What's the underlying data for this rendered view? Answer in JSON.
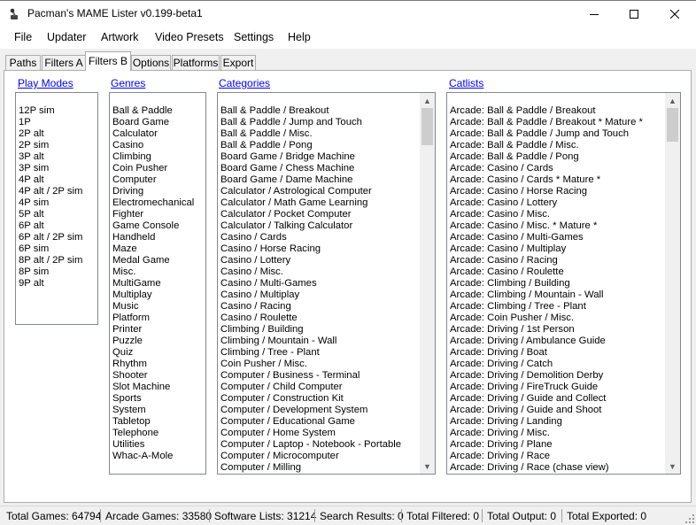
{
  "window": {
    "title": "Pacman's MAME Lister v0.199-beta1"
  },
  "menu": [
    "File",
    "Updater",
    "Artwork",
    "Video Presets",
    "Settings",
    "Help"
  ],
  "tabs": {
    "items": [
      "Paths",
      "Filters A",
      "Filters B",
      "Options",
      "Platforms",
      "Export"
    ],
    "active": "Filters B"
  },
  "play_modes": {
    "header": "Play Modes",
    "items": [
      "12P sim",
      "1P",
      "2P alt",
      "2P sim",
      "3P alt",
      "3P sim",
      "4P alt",
      "4P alt / 2P sim",
      "4P sim",
      "5P alt",
      "6P alt",
      "6P alt / 2P sim",
      "6P sim",
      "8P alt / 2P sim",
      "8P sim",
      "9P alt"
    ]
  },
  "genres": {
    "header": "Genres",
    "items": [
      "Ball & Paddle",
      "Board Game",
      "Calculator",
      "Casino",
      "Climbing",
      "Coin Pusher",
      "Computer",
      "Driving",
      "Electromechanical",
      "Fighter",
      "Game Console",
      "Handheld",
      "Maze",
      "Medal Game",
      "Misc.",
      "MultiGame",
      "Multiplay",
      "Music",
      "Platform",
      "Printer",
      "Puzzle",
      "Quiz",
      "Rhythm",
      "Shooter",
      "Slot Machine",
      "Sports",
      "System",
      "Tabletop",
      "Telephone",
      "Utilities",
      "Whac-A-Mole"
    ]
  },
  "categories": {
    "header": "Categories",
    "items": [
      "Ball & Paddle / Breakout",
      "Ball & Paddle / Jump and Touch",
      "Ball & Paddle / Misc.",
      "Ball & Paddle / Pong",
      "Board Game / Bridge Machine",
      "Board Game / Chess Machine",
      "Board Game / Dame Machine",
      "Calculator / Astrological Computer",
      "Calculator / Math Game Learning",
      "Calculator / Pocket Computer",
      "Calculator / Talking Calculator",
      "Casino / Cards",
      "Casino / Horse Racing",
      "Casino / Lottery",
      "Casino / Misc.",
      "Casino / Multi-Games",
      "Casino / Multiplay",
      "Casino / Racing",
      "Casino / Roulette",
      "Climbing / Building",
      "Climbing / Mountain - Wall",
      "Climbing / Tree - Plant",
      "Coin Pusher / Misc.",
      "Computer / Business - Terminal",
      "Computer / Child Computer",
      "Computer / Construction Kit",
      "Computer / Development System",
      "Computer / Educational Game",
      "Computer / Home System",
      "Computer / Laptop - Notebook - Portable",
      "Computer / Microcomputer",
      "Computer / Milling"
    ]
  },
  "catlists": {
    "header": "Catlists",
    "items": [
      "Arcade: Ball & Paddle / Breakout",
      "Arcade: Ball & Paddle / Breakout * Mature *",
      "Arcade: Ball & Paddle / Jump and Touch",
      "Arcade: Ball & Paddle / Misc.",
      "Arcade: Ball & Paddle / Pong",
      "Arcade: Casino / Cards",
      "Arcade: Casino / Cards * Mature *",
      "Arcade: Casino / Horse Racing",
      "Arcade: Casino / Lottery",
      "Arcade: Casino / Misc.",
      "Arcade: Casino / Misc. * Mature *",
      "Arcade: Casino / Multi-Games",
      "Arcade: Casino / Multiplay",
      "Arcade: Casino / Racing",
      "Arcade: Casino / Roulette",
      "Arcade: Climbing / Building",
      "Arcade: Climbing / Mountain - Wall",
      "Arcade: Climbing / Tree - Plant",
      "Arcade: Coin Pusher / Misc.",
      "Arcade: Driving / 1st Person",
      "Arcade: Driving / Ambulance Guide",
      "Arcade: Driving / Boat",
      "Arcade: Driving / Catch",
      "Arcade: Driving / Demolition Derby",
      "Arcade: Driving / FireTruck Guide",
      "Arcade: Driving / Guide and Collect",
      "Arcade: Driving / Guide and Shoot",
      "Arcade: Driving / Landing",
      "Arcade: Driving / Misc.",
      "Arcade: Driving / Plane",
      "Arcade: Driving / Race",
      "Arcade: Driving / Race (chase view)"
    ]
  },
  "status": {
    "total_games": "Total Games: 64794",
    "arcade_games": "Arcade Games: 33580",
    "software_lists": "Software Lists: 31214",
    "search_results": "Search Results: 0",
    "total_filtered": "Total Filtered: 0",
    "total_output": "Total Output: 0",
    "total_exported": "Total Exported: 0"
  },
  "icons": {
    "app": "joystick-icon",
    "minimize": "minimize-icon",
    "maximize": "maximize-icon",
    "close": "close-icon",
    "scroll_up": "chevron-up-icon",
    "scroll_down": "chevron-down-icon",
    "grip": "resize-grip-icon"
  }
}
